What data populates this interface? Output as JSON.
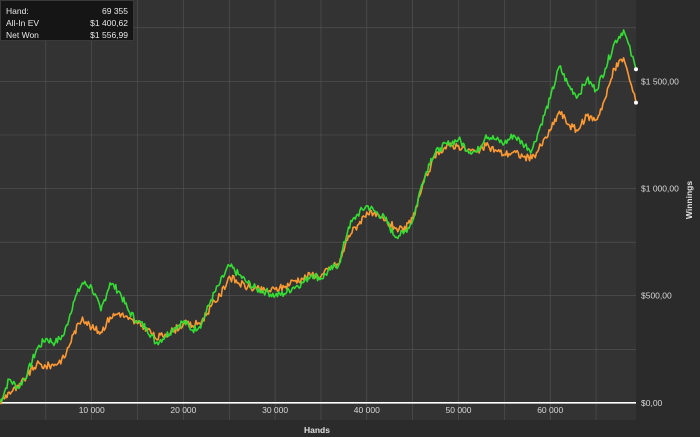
{
  "legend": {
    "rows": [
      {
        "label": "Hand:",
        "value": "69 355"
      },
      {
        "label": "All-In EV",
        "value": "$1 400,62"
      },
      {
        "label": "Net Won",
        "value": "$1 556,99"
      }
    ]
  },
  "colors": {
    "background": "#2b2b2b",
    "plot_background": "#333333",
    "grid": "#555555",
    "net_won": "#33dd33",
    "all_in_ev": "#ff9933",
    "zero_line": "#ffffff"
  },
  "chart_data": {
    "type": "line",
    "xlabel": "Hands",
    "ylabel": "Winnings",
    "xlim": [
      0,
      69355
    ],
    "ylim": [
      -80,
      1880
    ],
    "x_ticks": [
      10000,
      20000,
      30000,
      40000,
      50000,
      60000
    ],
    "x_tick_labels": [
      "10 000",
      "20 000",
      "30 000",
      "40 000",
      "50 000",
      "60 000"
    ],
    "y_ticks": [
      0,
      500,
      1000,
      1500
    ],
    "y_tick_labels": [
      "$0,00",
      "$500,00",
      "$1 000,00",
      "$1 500,00"
    ],
    "grid": true,
    "x": [
      0,
      1000,
      2000,
      3000,
      4000,
      5000,
      6000,
      7000,
      8000,
      9000,
      10000,
      11000,
      12000,
      13000,
      14000,
      15000,
      16000,
      17000,
      18000,
      19000,
      20000,
      21000,
      22000,
      23000,
      24000,
      25000,
      26000,
      27000,
      28000,
      29000,
      30000,
      31000,
      32000,
      33000,
      34000,
      35000,
      36000,
      37000,
      38000,
      39000,
      40000,
      41000,
      42000,
      43000,
      44000,
      45000,
      46000,
      47000,
      48000,
      49000,
      50000,
      51000,
      52000,
      53000,
      54000,
      55000,
      56000,
      57000,
      58000,
      59000,
      60000,
      61000,
      62000,
      63000,
      64000,
      65000,
      66000,
      67000,
      68000,
      69355
    ],
    "series": [
      {
        "name": "Net Won",
        "values": [
          0,
          110,
          70,
          140,
          250,
          300,
          280,
          320,
          470,
          560,
          540,
          430,
          560,
          520,
          430,
          380,
          350,
          280,
          310,
          350,
          380,
          340,
          370,
          480,
          560,
          640,
          600,
          560,
          530,
          520,
          500,
          510,
          540,
          560,
          600,
          580,
          620,
          650,
          820,
          880,
          920,
          890,
          860,
          780,
          790,
          850,
          1020,
          1140,
          1190,
          1210,
          1230,
          1180,
          1170,
          1250,
          1230,
          1210,
          1250,
          1210,
          1180,
          1300,
          1420,
          1570,
          1480,
          1430,
          1510,
          1460,
          1560,
          1680,
          1740,
          1557
        ]
      },
      {
        "name": "All-In EV",
        "values": [
          0,
          50,
          70,
          130,
          180,
          170,
          180,
          210,
          320,
          400,
          350,
          330,
          400,
          420,
          390,
          370,
          350,
          300,
          320,
          340,
          370,
          360,
          380,
          450,
          500,
          590,
          560,
          540,
          530,
          520,
          530,
          540,
          570,
          580,
          600,
          590,
          630,
          650,
          780,
          830,
          890,
          870,
          850,
          820,
          800,
          860,
          1000,
          1110,
          1180,
          1200,
          1200,
          1180,
          1170,
          1200,
          1180,
          1160,
          1170,
          1150,
          1140,
          1200,
          1270,
          1360,
          1300,
          1270,
          1340,
          1320,
          1420,
          1560,
          1610,
          1401
        ]
      }
    ]
  }
}
